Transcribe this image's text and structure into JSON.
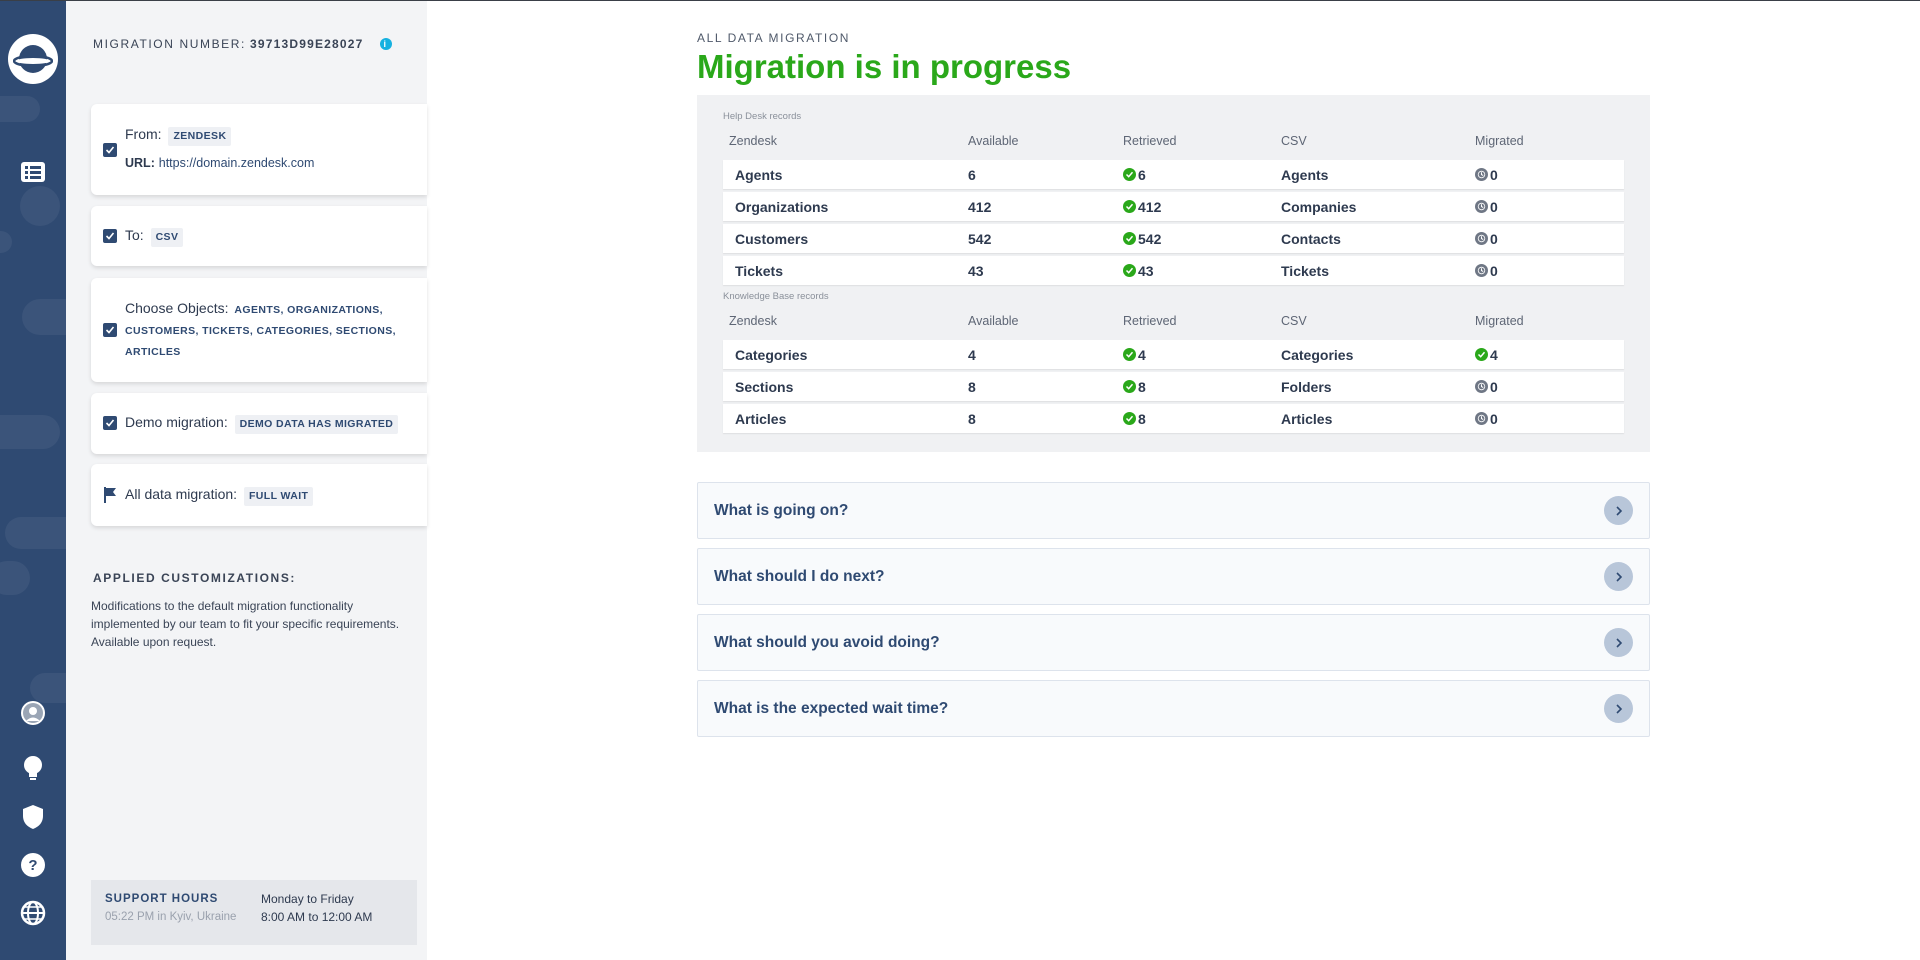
{
  "sidebar": {
    "migration_label": "MIGRATION NUMBER:",
    "migration_number": "39713D99E28027",
    "steps": {
      "from_label": "From:",
      "from_value": "ZENDESK",
      "url_label": "URL:",
      "url_value": "https://domain.zendesk.com",
      "to_label": "To:",
      "to_value": "CSV",
      "objects_label": "Choose Objects:",
      "objects_value_1": "AGENTS, ORGANIZATIONS,",
      "objects_value_2": "CUSTOMERS, TICKETS, CATEGORIES, SECTIONS,",
      "objects_value_3": "ARTICLES",
      "demo_label": "Demo migration:",
      "demo_value": "DEMO DATA HAS MIGRATED",
      "full_label": "All data migration:",
      "full_value": "FULL WAIT"
    },
    "customizations_title": "APPLIED CUSTOMIZATIONS:",
    "customizations_desc": "Modifications to the default migration functionality implemented by our team to fit your specific requirements. Available upon request.",
    "support": {
      "title": "SUPPORT HOURS",
      "local_time": "05:22 PM in Kyiv, Ukraine",
      "days": "Monday to Friday",
      "hours": "8:00 AM to 12:00 AM"
    }
  },
  "main": {
    "kicker": "ALL DATA MIGRATION",
    "title": "Migration is in progress",
    "helpdesk": {
      "label": "Help Desk records",
      "headers": [
        "Zendesk",
        "Available",
        "Retrieved",
        "CSV",
        "Migrated"
      ],
      "rows": [
        {
          "source": "Agents",
          "available": "6",
          "retrieved": "6",
          "target": "Agents",
          "migrated": "0"
        },
        {
          "source": "Organizations",
          "available": "412",
          "retrieved": "412",
          "target": "Companies",
          "migrated": "0"
        },
        {
          "source": "Customers",
          "available": "542",
          "retrieved": "542",
          "target": "Contacts",
          "migrated": "0"
        },
        {
          "source": "Tickets",
          "available": "43",
          "retrieved": "43",
          "target": "Tickets",
          "migrated": "0"
        }
      ]
    },
    "kb": {
      "label": "Knowledge Base records",
      "headers": [
        "Zendesk",
        "Available",
        "Retrieved",
        "CSV",
        "Migrated"
      ],
      "rows": [
        {
          "source": "Categories",
          "available": "4",
          "retrieved": "4",
          "target": "Categories",
          "migrated": "4"
        },
        {
          "source": "Sections",
          "available": "8",
          "retrieved": "8",
          "target": "Folders",
          "migrated": "0"
        },
        {
          "source": "Articles",
          "available": "8",
          "retrieved": "8",
          "target": "Articles",
          "migrated": "0"
        }
      ]
    },
    "faq": [
      "What is going on?",
      "What should I do next?",
      "What should you avoid doing?",
      "What is the expected wait time?"
    ]
  },
  "colors": {
    "rail": "#2f4a72",
    "success": "#2aa81a",
    "info": "#16b1e0"
  },
  "icons": [
    "logo-icon",
    "list-icon",
    "avatar-icon",
    "bulb-icon",
    "shield-icon",
    "help-icon",
    "globe-icon",
    "info-icon",
    "checkbox-icon",
    "flag-icon",
    "check-circle-icon",
    "clock-icon",
    "chevron-right-icon"
  ]
}
